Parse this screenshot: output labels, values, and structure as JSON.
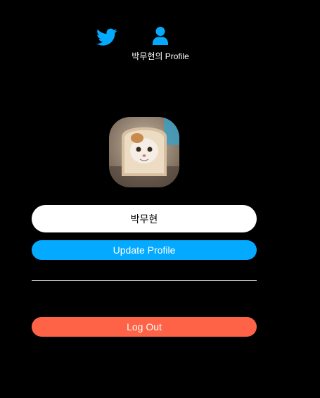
{
  "nav": {
    "home_icon": "twitter-icon",
    "profile_icon": "user-icon",
    "profile_label": "박무현의 Profile",
    "accent_color": "#04aaff"
  },
  "profile": {
    "avatar_alt": "profile photo",
    "display_name_value": "박무현"
  },
  "buttons": {
    "update_label": "Update Profile",
    "update_color": "#04aaff",
    "logout_label": "Log Out",
    "logout_color": "#ff6347"
  }
}
